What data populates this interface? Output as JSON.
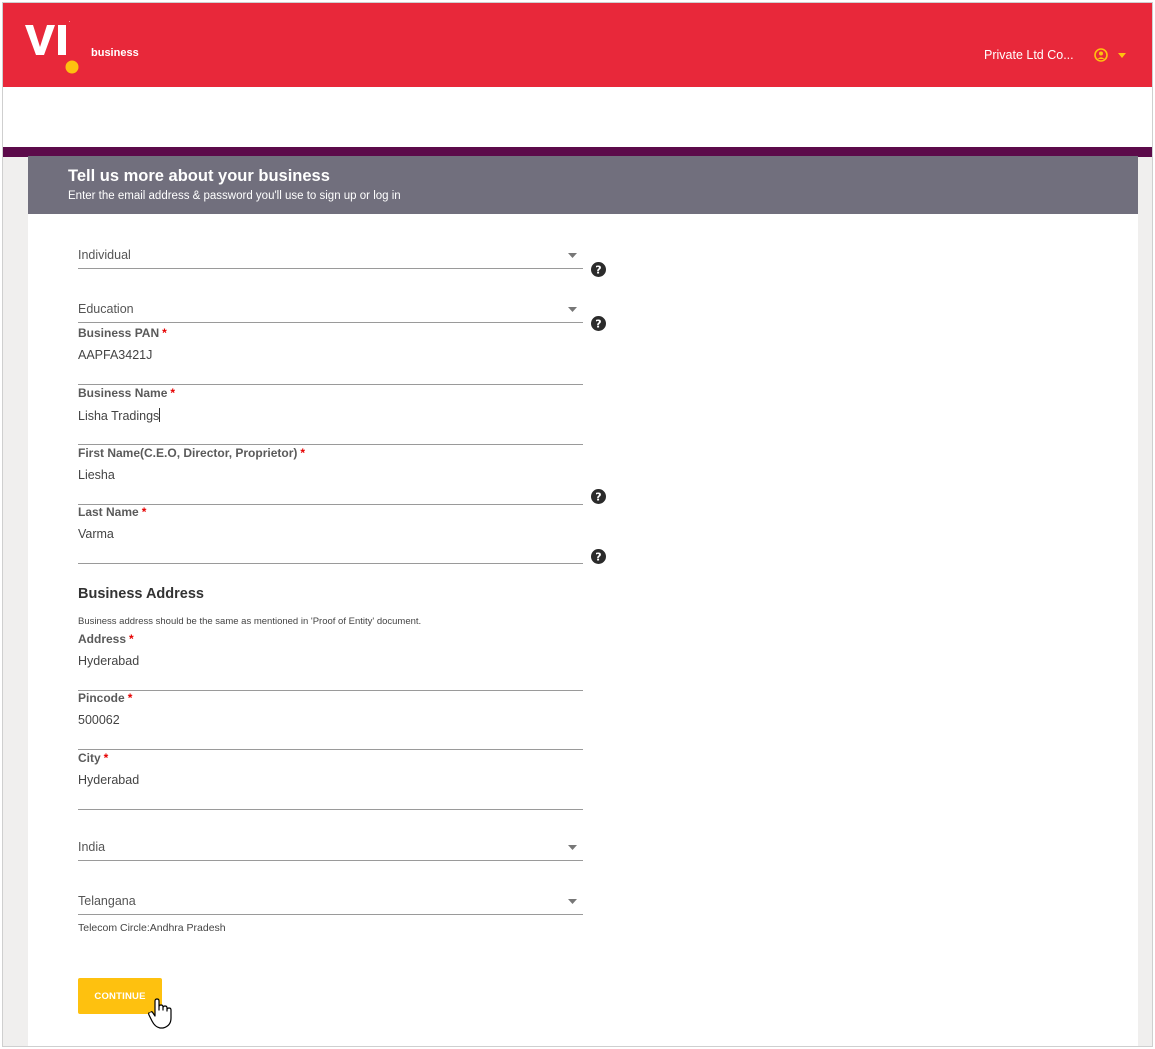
{
  "brand": {
    "logo_text": "business",
    "primary_color": "#e8283a",
    "accent_color": "#fec10f",
    "band_color": "#5c0a4a"
  },
  "header": {
    "company_name": "Private Ltd Co...",
    "user_icon": "user-circle-icon",
    "menu_icon": "caret-down-icon"
  },
  "form": {
    "title": "Tell us more about your business",
    "subtitle": "Enter the email address & password you'll use to sign up or log in",
    "entity_type": "Individual",
    "industry": "Education",
    "business_pan": {
      "label": "Business PAN",
      "value": "AAPFA3421J"
    },
    "business_name": {
      "label": "Business Name",
      "value": "Lisha Tradings"
    },
    "first_name": {
      "label": "First Name(C.E.O, Director, Proprietor)",
      "value": "Liesha"
    },
    "last_name": {
      "label": "Last Name",
      "value": "Varma"
    },
    "required_mark": "*",
    "address_section": {
      "title": "Business Address",
      "note": "Business address should be the same as mentioned in 'Proof of Entity' document."
    },
    "address": {
      "label": "Address",
      "value": "Hyderabad"
    },
    "pincode": {
      "label": "Pincode",
      "value": "500062"
    },
    "city": {
      "label": "City",
      "value": "Hyderabad"
    },
    "country": "India",
    "state": "Telangana",
    "telecom_circle": "Telecom Circle:Andhra Pradesh",
    "continue_label": "CONTINUE",
    "help_icon": "question-circle-icon"
  }
}
